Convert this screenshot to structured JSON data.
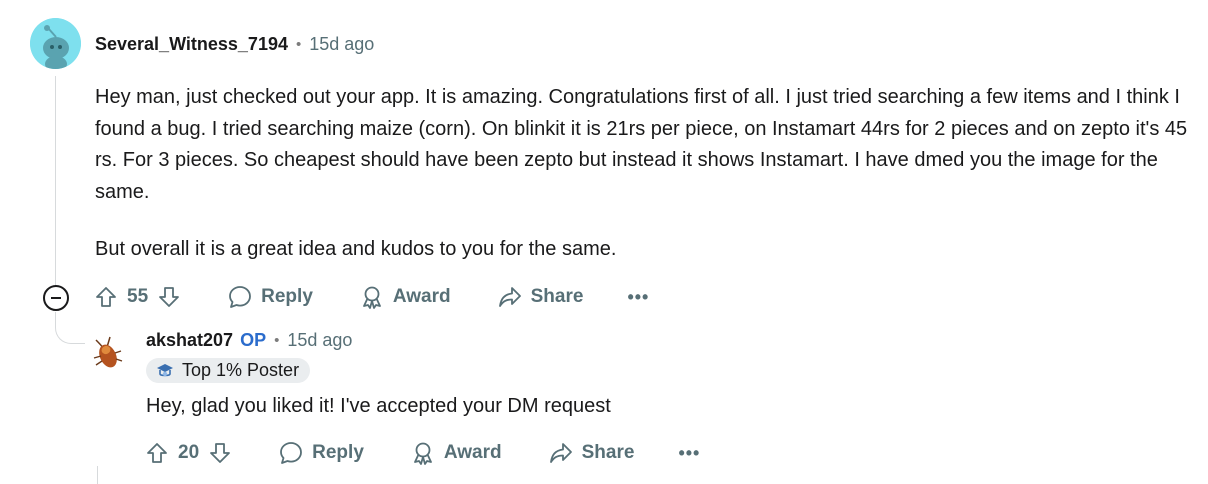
{
  "comment": {
    "author": "Several_Witness_7194",
    "separator": "•",
    "time": "15d ago",
    "paragraphs": [
      "Hey man, just checked out your app. It is amazing. Congratulations first of all. I just tried searching a few items and I think I found a bug. I tried searching maize (corn). On blinkit it is 21rs per piece, on Instamart 44rs for 2 pieces and on zepto it's 45 rs. For 3 pieces. So cheapest should have been zepto but instead it shows Instamart. I have dmed you the image for the same.",
      "But overall it is a great idea and kudos to you for the same."
    ],
    "votes": "55",
    "actions": {
      "reply": "Reply",
      "award": "Award",
      "share": "Share",
      "more": "•••"
    }
  },
  "reply": {
    "author": "akshat207",
    "op_label": "OP",
    "separator": "•",
    "time": "15d ago",
    "flair": "Top 1% Poster",
    "text": "Hey, glad you liked it! I've accepted your DM request",
    "votes": "20",
    "actions": {
      "reply": "Reply",
      "award": "Award",
      "share": "Share",
      "more": "•••"
    }
  },
  "colors": {
    "accent_op": "#2b6ccc",
    "meta_gray": "#576f76",
    "avatar_bg": "#7ee0ee"
  }
}
